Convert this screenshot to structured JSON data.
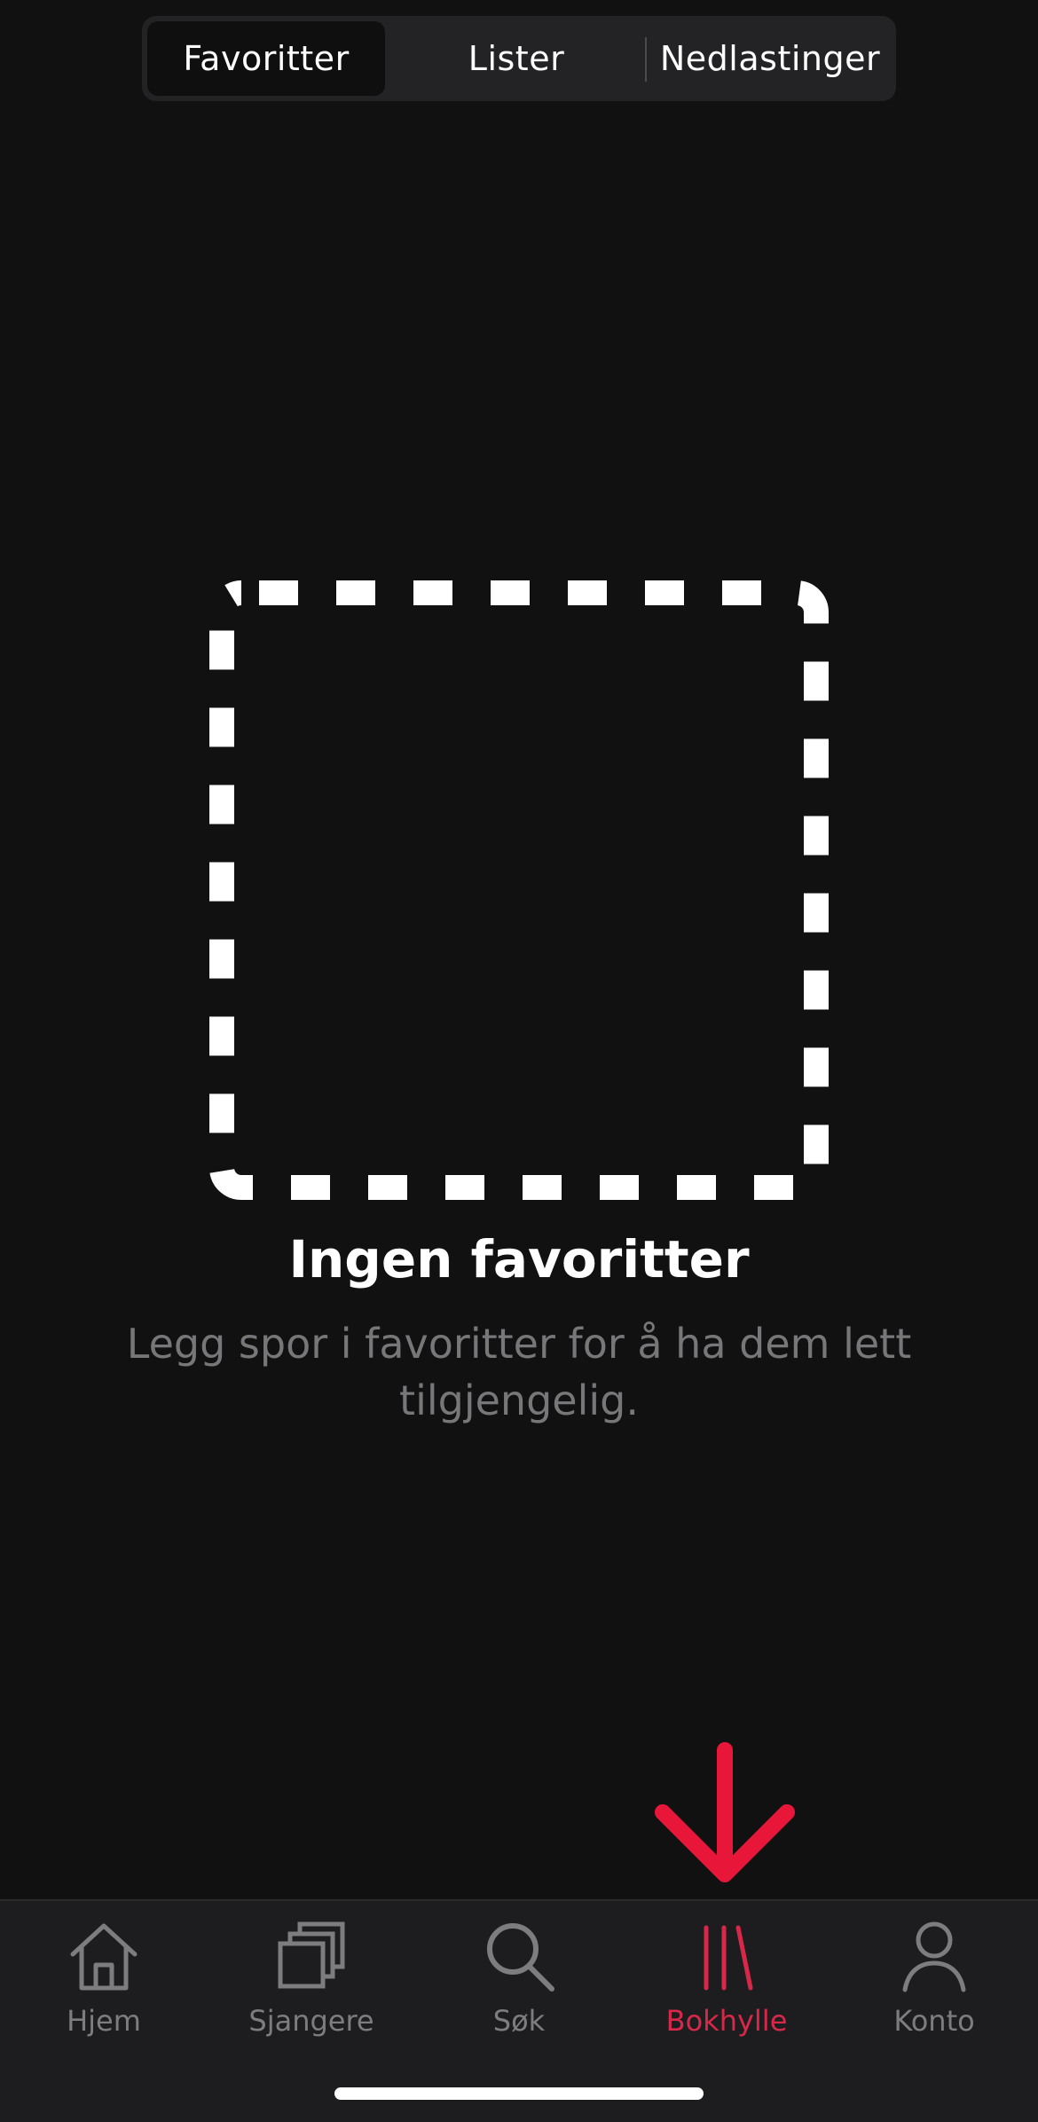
{
  "segmented": {
    "tabs": [
      {
        "label": "Favoritter",
        "selected": true
      },
      {
        "label": "Lister",
        "selected": false
      },
      {
        "label": "Nedlastinger",
        "selected": false
      }
    ]
  },
  "empty_state": {
    "icon": "dashed-square-icon",
    "title": "Ingen favoritter",
    "subtitle": "Legg spor i favoritter for å ha dem lett tilgjengelig."
  },
  "annotation": {
    "icon": "down-arrow-icon",
    "color": "#e8173a"
  },
  "tabbar": {
    "items": [
      {
        "label": "Hjem",
        "icon": "home-icon",
        "active": false
      },
      {
        "label": "Sjangere",
        "icon": "stacked-squares-icon",
        "active": false
      },
      {
        "label": "Søk",
        "icon": "search-icon",
        "active": false
      },
      {
        "label": "Bokhylle",
        "icon": "bookshelf-icon",
        "active": true
      },
      {
        "label": "Konto",
        "icon": "person-icon",
        "active": false
      }
    ],
    "active_color": "#d8284a",
    "inactive_color": "#7d7d80"
  }
}
